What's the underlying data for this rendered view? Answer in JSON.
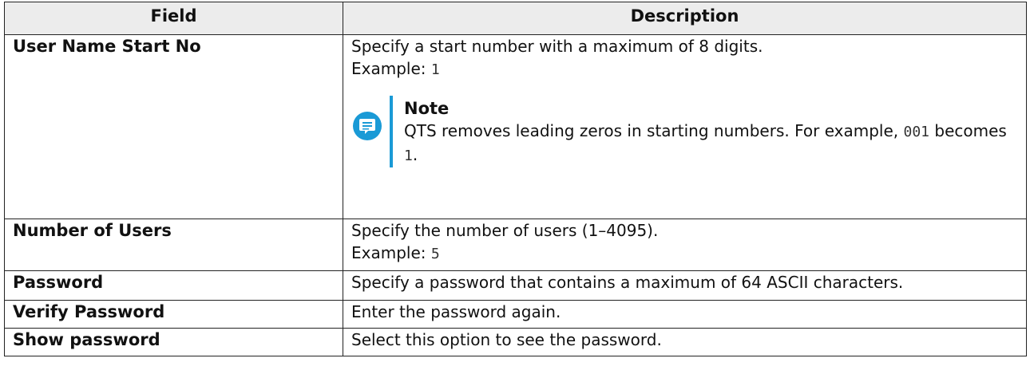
{
  "table": {
    "headers": [
      "Field",
      "Description"
    ],
    "rows": [
      {
        "field": "User Name Start No",
        "description": "Specify a start number with a maximum of 8 digits.",
        "example_label": "Example:",
        "example_value": "1",
        "note": {
          "title": "Note",
          "text_before": "QTS removes leading zeros in starting numbers. For example,",
          "code_a": "001",
          "text_mid": "becomes",
          "code_b": "1",
          "text_end": "."
        }
      },
      {
        "field": "Number of Users",
        "description": "Specify the number of users (1–4095).",
        "example_label": "Example:",
        "example_value": "5"
      },
      {
        "field": "Password",
        "description": "Specify a password that contains a maximum of 64 ASCII characters."
      },
      {
        "field": "Verify Password",
        "description": "Enter the password again."
      },
      {
        "field": "Show password",
        "description": "Select this option to see the password."
      }
    ]
  },
  "icons": {
    "note_icon": "note-speech-bubble-icon"
  },
  "colors": {
    "header_bg": "#ececec",
    "note_accent": "#1a9ad6"
  }
}
